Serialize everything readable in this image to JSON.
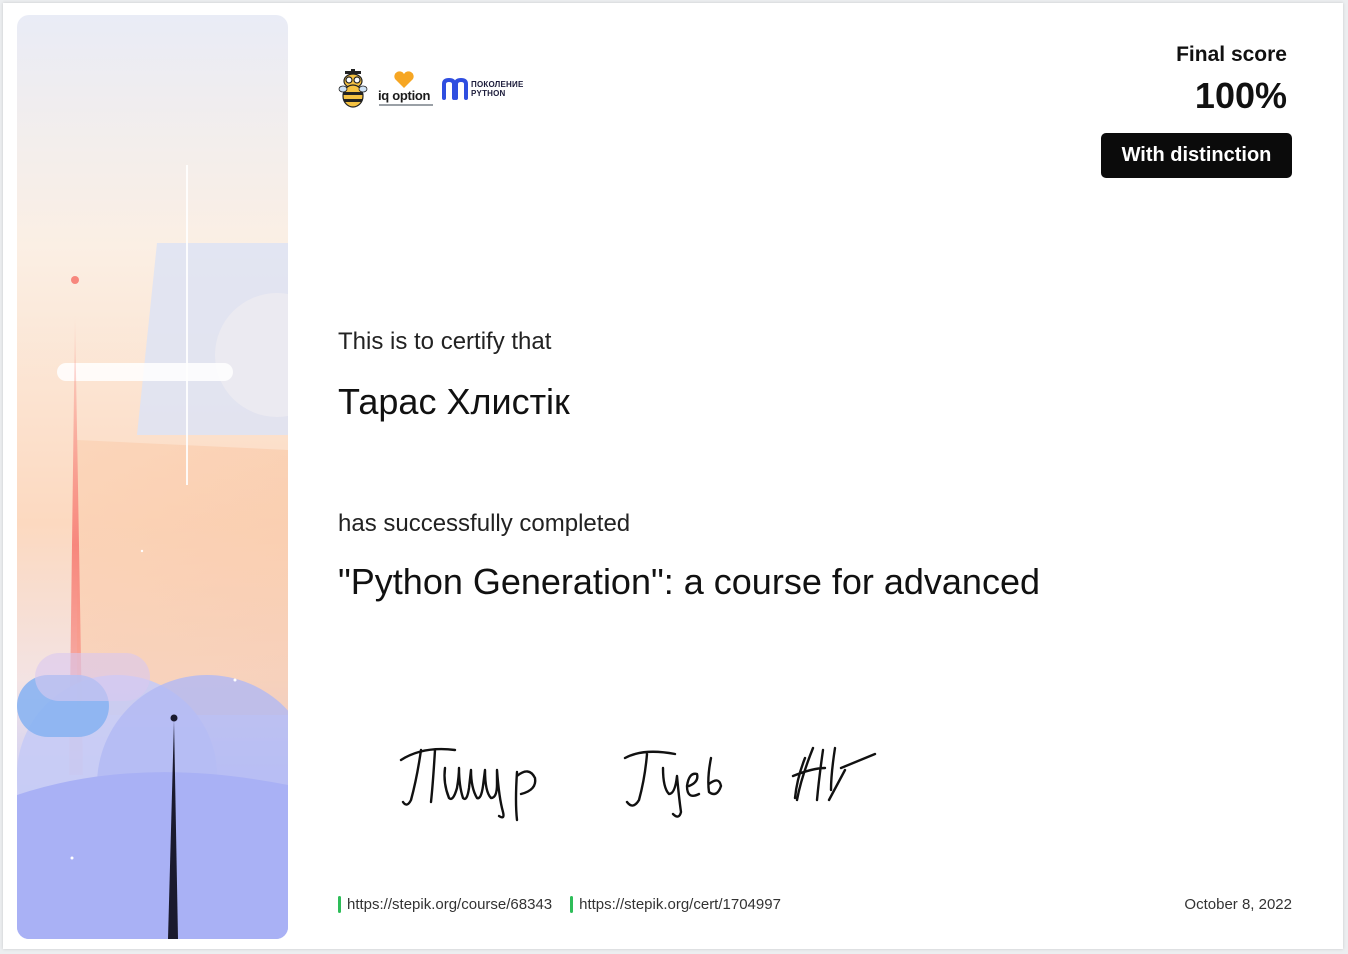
{
  "logos": {
    "iq_option": "iq option",
    "python_gen_line1": "ПОКОЛЕНИЕ",
    "python_gen_line2": "PYTHON",
    "bee_icon": "bee-mascot-icon",
    "heart_icon": "heart-icon"
  },
  "score": {
    "label": "Final score",
    "value": "100%",
    "badge": "With distinction"
  },
  "certificate": {
    "certify_text": "This is to certify that",
    "name": "Тарас Хлистік",
    "completed_text": "has successfully completed",
    "course": "\"Python Generation\": a course for advanced"
  },
  "footer": {
    "course_url": "https://stepik.org/course/68343",
    "cert_url": "https://stepik.org/cert/1704997",
    "date": "October 8, 2022"
  },
  "colors": {
    "badge_bg": "#0b0b0b",
    "link_marker": "#2ebd59",
    "art_peach": "#f8c9a8",
    "art_blue": "#9ea8f5",
    "art_red": "#f7877d"
  }
}
